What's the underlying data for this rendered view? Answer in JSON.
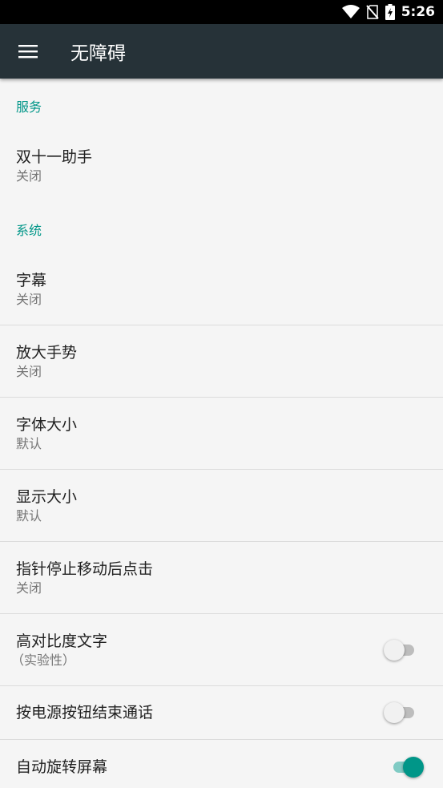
{
  "status_bar": {
    "time": "5:26",
    "icons": [
      "wifi-icon",
      "no-sim-icon",
      "battery-charging-icon"
    ]
  },
  "app_bar": {
    "menu_icon": "hamburger-menu-icon",
    "title": "无障碍"
  },
  "sections": {
    "services": {
      "header": "服务",
      "items": [
        {
          "title": "双十一助手",
          "summary": "关闭"
        }
      ]
    },
    "system": {
      "header": "系统",
      "items": [
        {
          "title": "字幕",
          "summary": "关闭"
        },
        {
          "title": "放大手势",
          "summary": "关闭"
        },
        {
          "title": "字体大小",
          "summary": "默认"
        },
        {
          "title": "显示大小",
          "summary": "默认"
        },
        {
          "title": "指针停止移动后点击",
          "summary": "关闭"
        },
        {
          "title": "高对比度文字",
          "summary": "（实验性）",
          "switch": false
        },
        {
          "title": "按电源按钮结束通话",
          "switch": false
        },
        {
          "title": "自动旋转屏幕",
          "switch": true
        }
      ]
    }
  },
  "colors": {
    "accent": "#009688",
    "app_bar": "#263238",
    "background": "#f5f5f5"
  }
}
